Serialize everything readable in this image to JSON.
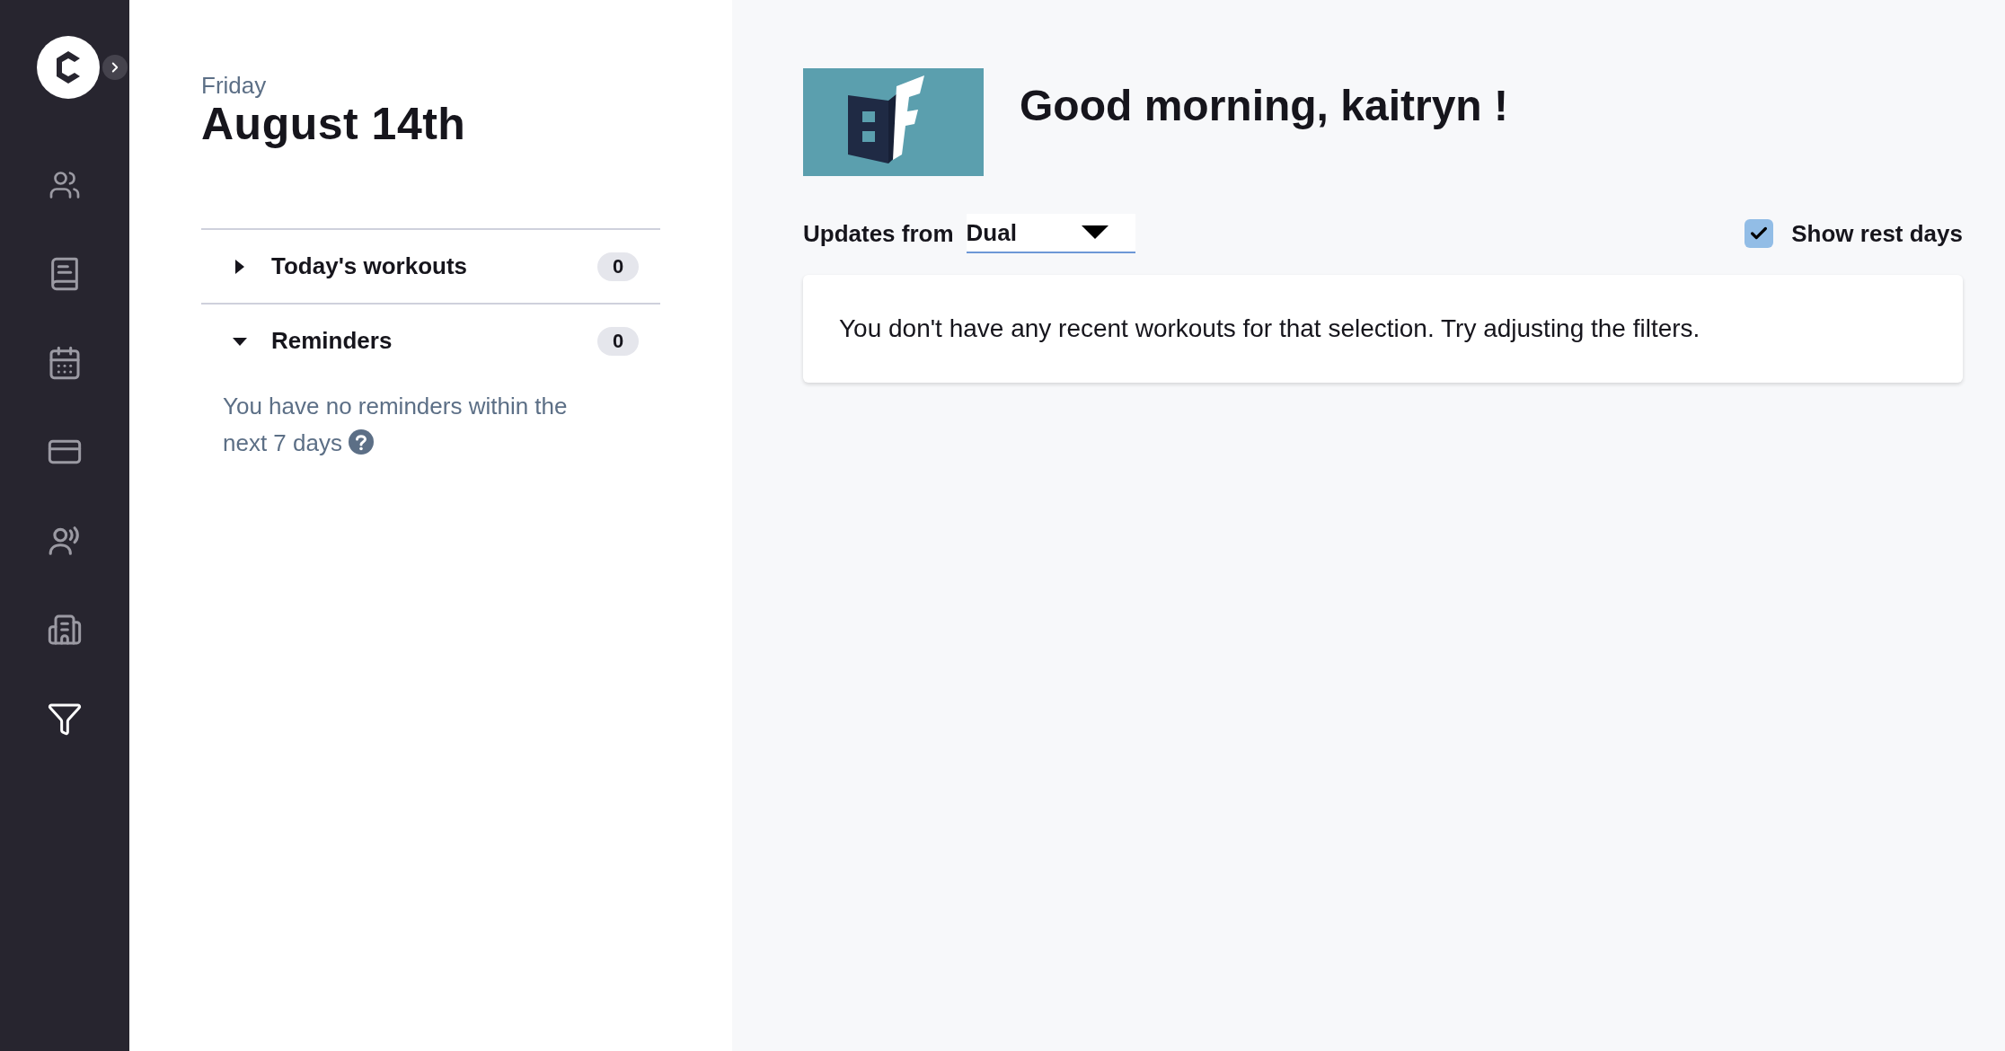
{
  "day": {
    "weekday": "Friday",
    "date": "August 14th"
  },
  "sections": [
    {
      "label": "Today's workouts",
      "count": "0",
      "expanded": false
    },
    {
      "label": "Reminders",
      "count": "0",
      "expanded": true,
      "empty_message": "You have no reminders within the next 7 days"
    }
  ],
  "greeting": "Good morning, kaitryn !",
  "updates_filter": {
    "label": "Updates from",
    "value": "Dual"
  },
  "show_rest_days": {
    "label": "Show rest days",
    "checked": true
  },
  "empty_state": "You don't have any recent workouts for that selection. Try adjusting the filters."
}
